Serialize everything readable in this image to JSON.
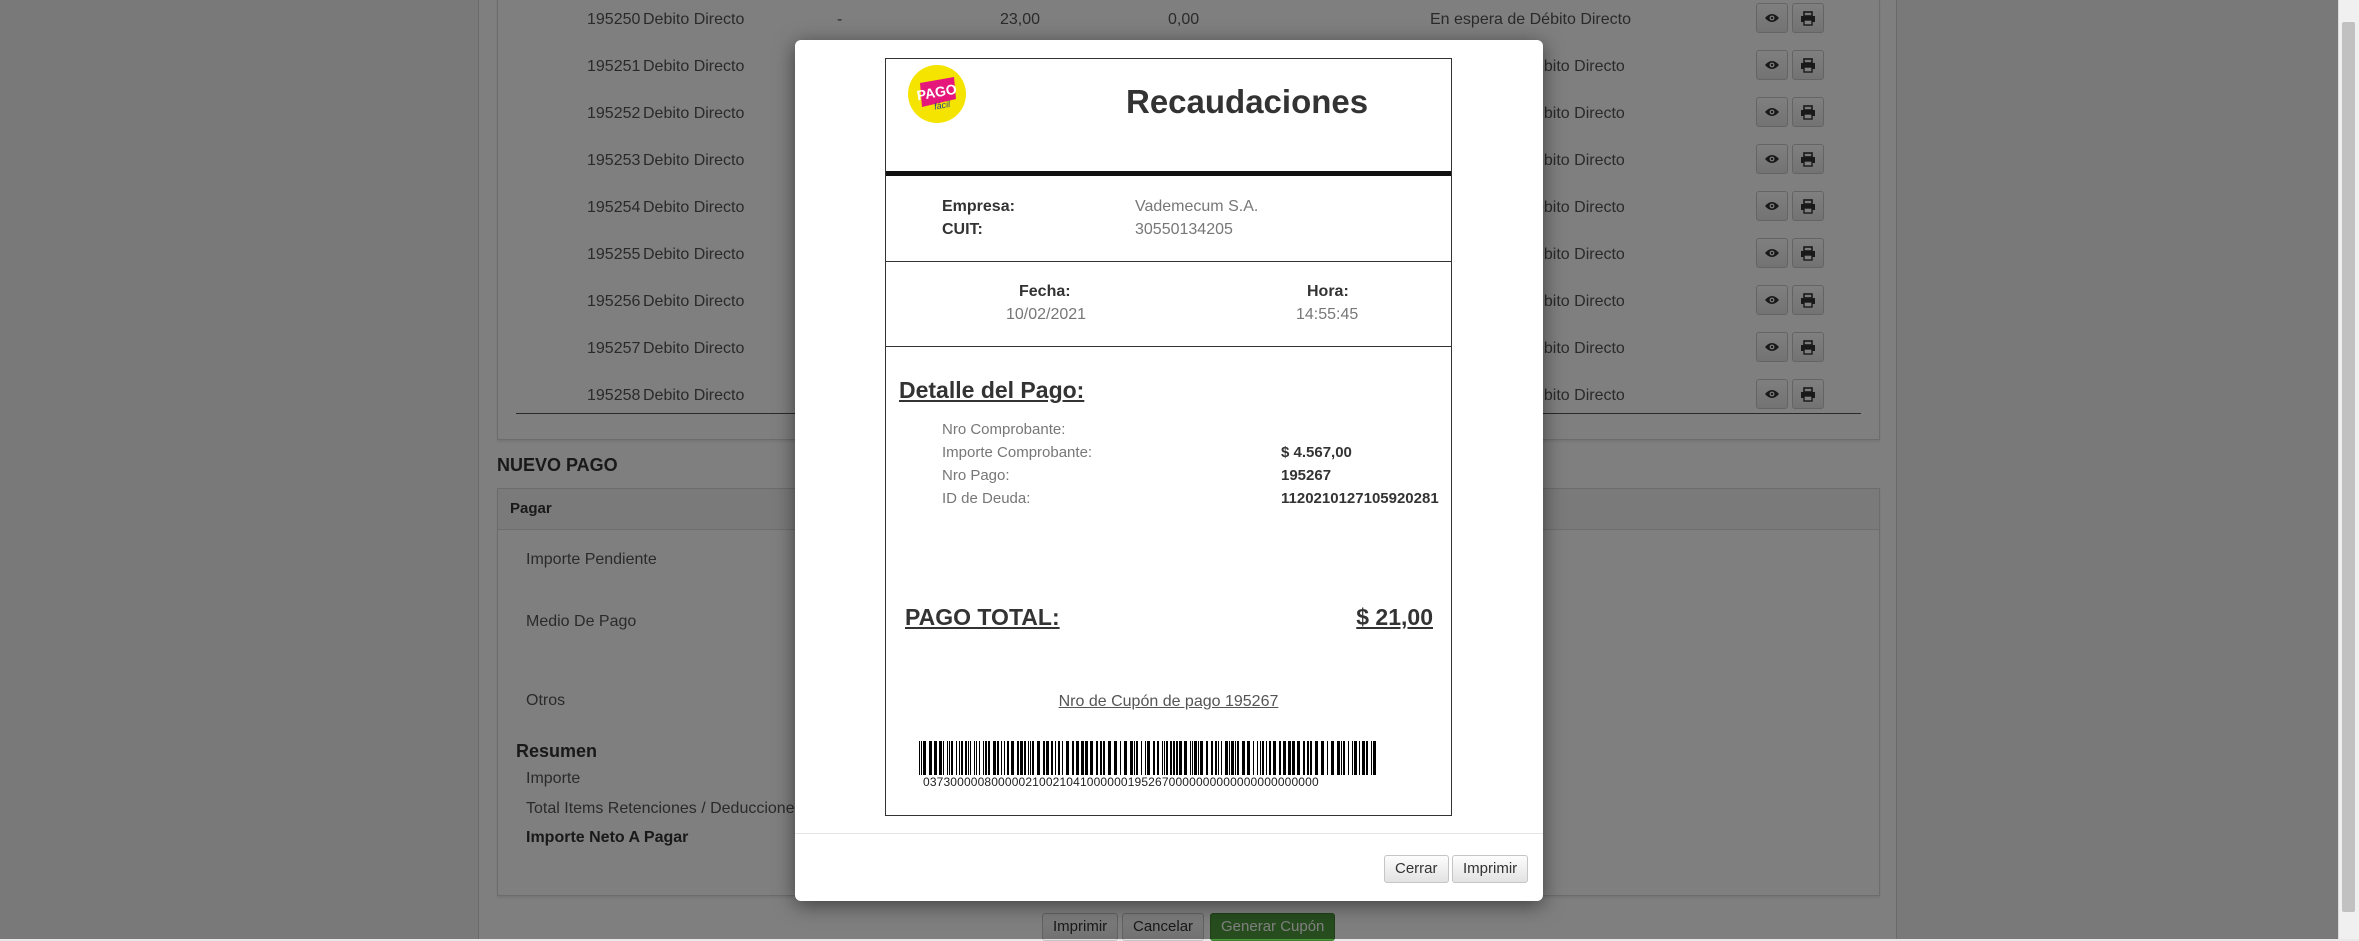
{
  "table": {
    "rows": [
      {
        "id": "195250",
        "medio": "Debito Directo",
        "extra": "-",
        "importe": "23,00",
        "saldo": "0,00",
        "estado": "En espera de Débito Directo"
      },
      {
        "id": "195251",
        "medio": "Debito Directo",
        "estado": "ébito Directo"
      },
      {
        "id": "195252",
        "medio": "Debito Directo",
        "estado": "ébito Directo"
      },
      {
        "id": "195253",
        "medio": "Debito Directo",
        "estado": "ébito Directo"
      },
      {
        "id": "195254",
        "medio": "Debito Directo",
        "estado": "ébito Directo"
      },
      {
        "id": "195255",
        "medio": "Debito Directo",
        "estado": "ébito Directo"
      },
      {
        "id": "195256",
        "medio": "Debito Directo",
        "estado": "ébito Directo"
      },
      {
        "id": "195257",
        "medio": "Debito Directo",
        "estado": "ébito Directo"
      },
      {
        "id": "195258",
        "medio": "Debito Directo",
        "estado": "ébito Directo"
      }
    ]
  },
  "nuevo_pago": {
    "title": "NUEVO PAGO",
    "panel_title": "Pagar",
    "importe_pendiente": "Importe Pendiente",
    "medio_de_pago": "Medio De Pago",
    "otros": "Otros",
    "resumen": "Resumen",
    "importe": "Importe",
    "total_items": "Total Items Retenciones / Deducciones",
    "importe_neto": "Importe Neto A Pagar"
  },
  "page_buttons": {
    "imprimir": "Imprimir",
    "cancelar": "Cancelar",
    "generar": "Generar Cupón"
  },
  "modal": {
    "logo_text": "PAGO",
    "logo_sub": "fácil",
    "title": "Recaudaciones",
    "empresa_label": "Empresa:",
    "empresa_value": "Vademecum S.A.",
    "cuit_label": "CUIT:",
    "cuit_value": "30550134205",
    "fecha_label": "Fecha:",
    "fecha_value": "10/02/2021",
    "hora_label": "Hora:",
    "hora_value": "14:55:45",
    "detalle_title": "Detalle del Pago:",
    "detalle": [
      {
        "label": "Nro Comprobante:",
        "value": ""
      },
      {
        "label": "Importe Comprobante:",
        "value": "$ 4.567,00"
      },
      {
        "label": "Nro Pago:",
        "value": "195267"
      },
      {
        "label": "ID de Deuda:",
        "value": "1120210127105920281"
      }
    ],
    "pago_total_label": "PAGO TOTAL:",
    "pago_total_value": "$ 21,00",
    "cupon_text": "Nro de Cupón de pago 195267",
    "barcode_digits": "0373000008000002100210410000001952670000000000000000000000",
    "cerrar": "Cerrar",
    "imprimir": "Imprimir",
    "colors": {
      "logo_yellow": "#f5e400",
      "logo_pink": "#e6177a",
      "logo_blue": "#1f3d8f"
    }
  }
}
